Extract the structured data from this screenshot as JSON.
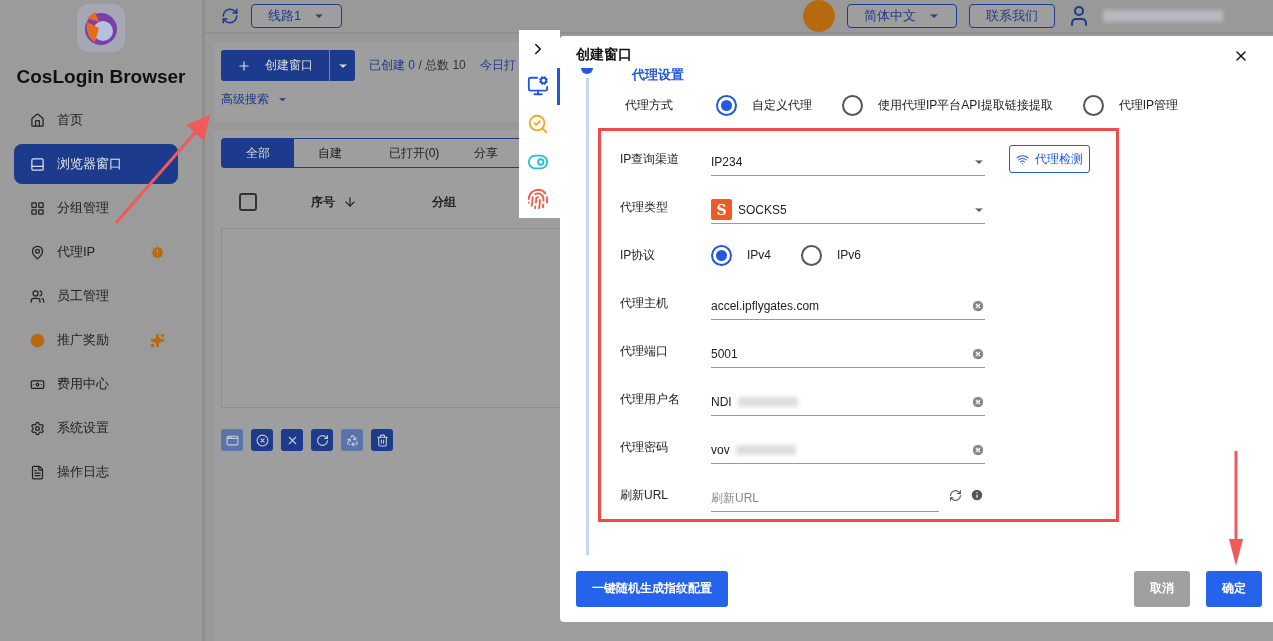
{
  "sidebar": {
    "brand": "CosLogin Browser",
    "items": [
      {
        "label": "首页",
        "selected": false,
        "alert": false,
        "sparkle": false
      },
      {
        "label": "浏览器窗口",
        "selected": true,
        "alert": false,
        "sparkle": false
      },
      {
        "label": "分组管理",
        "selected": false,
        "alert": false,
        "sparkle": false
      },
      {
        "label": "代理IP",
        "selected": false,
        "alert": true,
        "sparkle": false
      },
      {
        "label": "员工管理",
        "selected": false,
        "alert": false,
        "sparkle": false
      },
      {
        "label": "推广奖励",
        "selected": false,
        "alert": false,
        "sparkle": true
      },
      {
        "label": "费用中心",
        "selected": false,
        "alert": false,
        "sparkle": false
      },
      {
        "label": "系统设置",
        "selected": false,
        "alert": false,
        "sparkle": false
      },
      {
        "label": "操作日志",
        "selected": false,
        "alert": false,
        "sparkle": false
      }
    ]
  },
  "topbar": {
    "route": "线路1",
    "language": "简体中文",
    "contact": "联系我们"
  },
  "toolbar": {
    "create_button": "创建窗口",
    "created_label": "已创建",
    "created": "0",
    "total": "/ 总数 10",
    "today": "今日打",
    "advanced_search": "高级搜索"
  },
  "tabs": [
    {
      "label": "全部",
      "selected": true
    },
    {
      "label": "自建",
      "selected": false
    },
    {
      "label": "已打开(0)",
      "selected": false
    },
    {
      "label": "分享",
      "selected": false
    }
  ],
  "table": {
    "select_all": false,
    "columns": [
      "序号",
      "分组"
    ]
  },
  "actions": [
    {
      "disabled": true
    },
    {
      "disabled": false
    },
    {
      "disabled": false
    },
    {
      "disabled": false
    },
    {
      "disabled": true
    },
    {
      "disabled": false
    }
  ],
  "side_panel": [
    {
      "selected": true
    },
    {
      "selected": false
    },
    {
      "selected": false
    },
    {
      "selected": false
    }
  ],
  "dialog": {
    "title": "创建窗口",
    "section": "代理设置",
    "proxy_mode": {
      "label": "代理方式",
      "options": [
        {
          "label": "自定义代理",
          "selected": true
        },
        {
          "label": "使用代理IP平台API提取链接提取",
          "selected": false
        },
        {
          "label": "代理IP管理",
          "selected": false
        }
      ]
    },
    "fields": [
      {
        "kind": "select",
        "label": "IP查询渠道",
        "value": "IP234",
        "action": "代理检测"
      },
      {
        "kind": "select",
        "label": "代理类型",
        "value": "SOCKS5",
        "type_badge": "S"
      },
      {
        "kind": "radio",
        "label": "IP协议",
        "options": [
          {
            "label": "IPv4",
            "selected": true
          },
          {
            "label": "IPv6",
            "selected": false
          }
        ]
      },
      {
        "kind": "text",
        "label": "代理主机",
        "value": "accel.ipflygates.com"
      },
      {
        "kind": "text",
        "label": "代理端口",
        "value": "5001"
      },
      {
        "kind": "text",
        "label": "代理用户名",
        "value": "NDI",
        "redacted": true
      },
      {
        "kind": "text",
        "label": "代理密码",
        "value": "vov",
        "redacted": true
      },
      {
        "kind": "url",
        "label": "刷新URL",
        "placeholder": "刷新URL"
      }
    ]
  },
  "footer": {
    "generate": "一键随机生成指纹配置",
    "cancel": "取消",
    "confirm": "确定"
  }
}
